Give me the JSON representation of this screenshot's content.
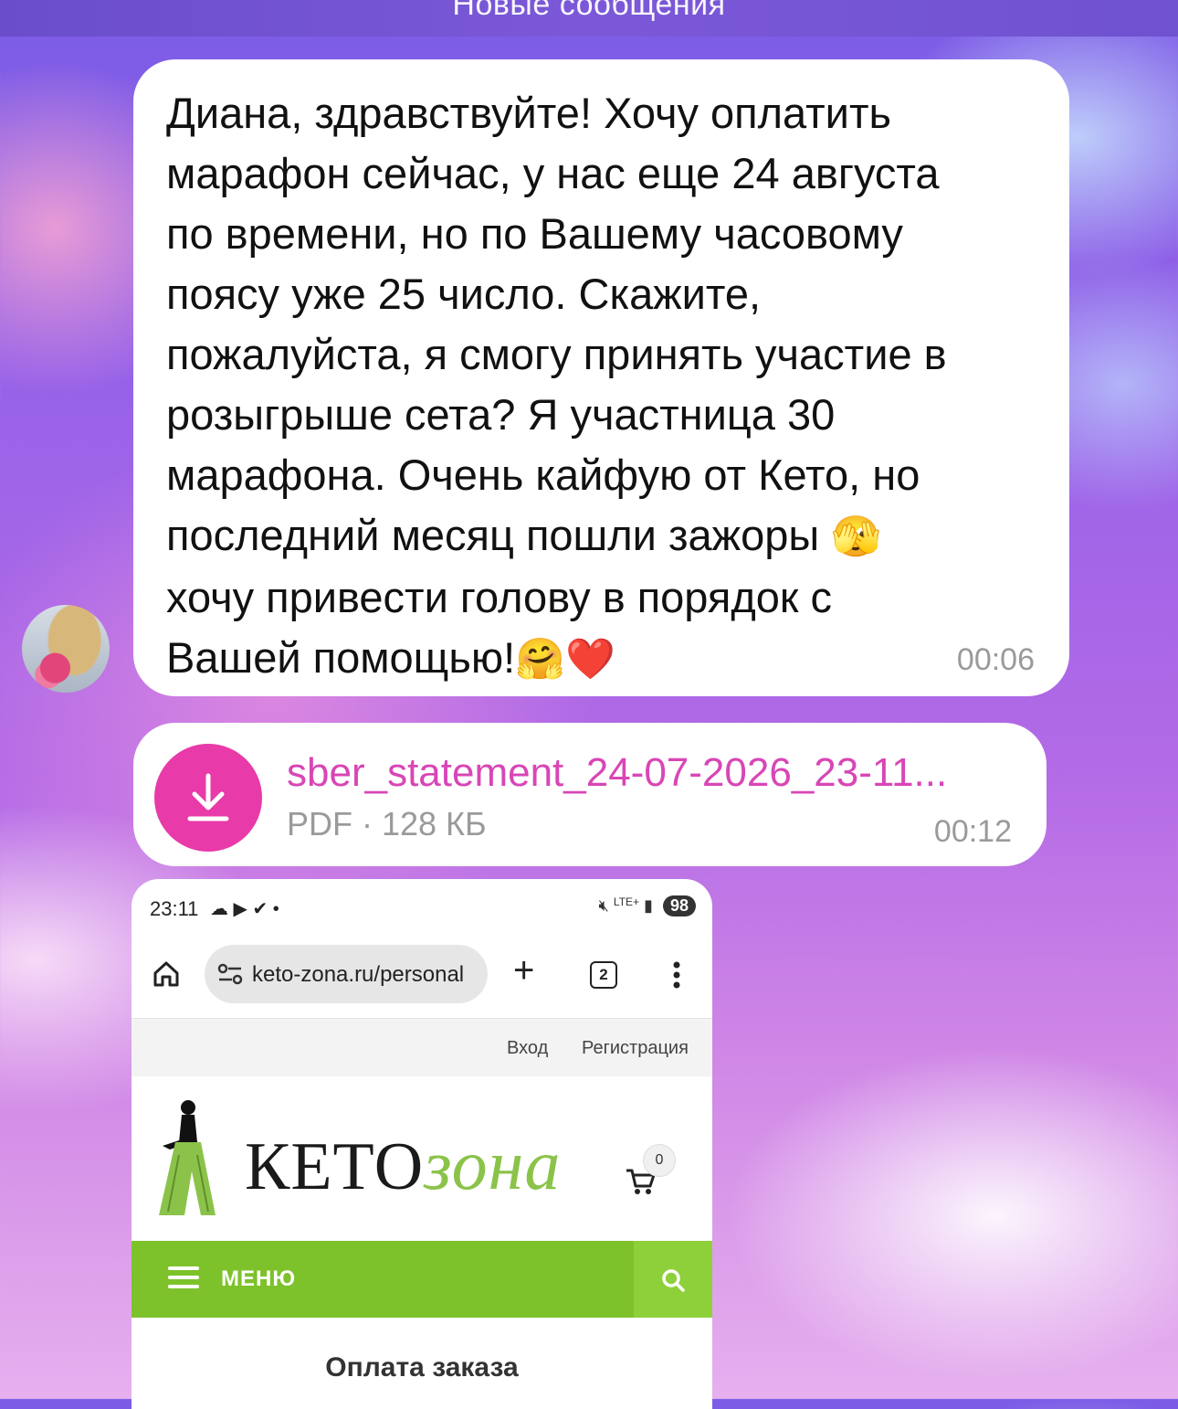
{
  "header": {
    "title": "Новые сообщения"
  },
  "message1": {
    "text": "Диана, здравствуйте! Хочу оплатить\nмарафон сейчас, у нас еще 24 августа\nпо времени, но по Вашему часовому\nпоясу уже 25 число. Скажите,\nпожалуйста, я смогу принять участие в\nрозыгрыше сета? Я участница 30\nмарафона. Очень кайфую от Кето, но\nпоследний месяц пошли зажоры ",
    "text_tail": "хочу привести голову в порядок с\nВашей помощью!",
    "emoji1": "🫣",
    "emoji2": "🤗",
    "emoji3": "❤️",
    "time": "00:06"
  },
  "message2": {
    "file_name": "sber_statement_24-07-2026_23-11...",
    "file_meta": "PDF · 128 КБ",
    "time": "00:12"
  },
  "screenshot": {
    "status_time": "23:11",
    "status_icons": "☁ ▶ ✔ •",
    "network": "LTE+",
    "battery": "98",
    "url": "keto-zona.ru/personal",
    "tab_count": "2",
    "login": "Вход",
    "register": "Регистрация",
    "logo_main": "КЕТО",
    "logo_accent": "зона",
    "cart_count": "0",
    "menu_label": "МЕНЮ",
    "page_heading": "Оплата заказа"
  },
  "colors": {
    "accent_pink": "#d846b6",
    "download_button": "#e83aa8",
    "keto_green": "#7dc22a"
  }
}
